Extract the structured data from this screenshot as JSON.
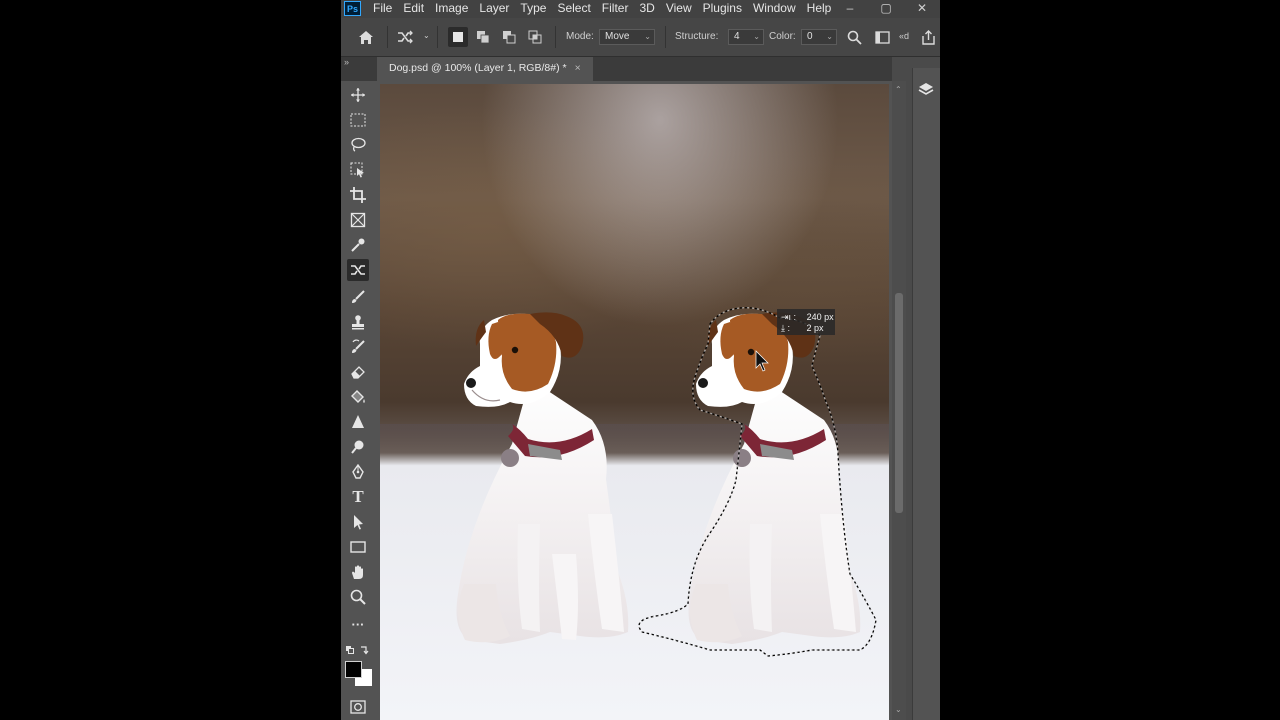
{
  "app": {
    "logo": "Ps",
    "accent": "#31a8ff"
  },
  "menu": [
    "File",
    "Edit",
    "Image",
    "Layer",
    "Type",
    "Select",
    "Filter",
    "3D",
    "View",
    "Plugins",
    "Window",
    "Help"
  ],
  "window_controls": {
    "minimize": "–",
    "maximize": "▢",
    "close": "✕"
  },
  "options": {
    "mode_label": "Mode:",
    "mode_value": "Move",
    "structure_label": "Structure:",
    "structure_value": "4",
    "color_label": "Color:",
    "color_value": "0",
    "extra_label": "«d"
  },
  "document_tab": {
    "title": "Dog.psd @ 100% (Layer 1, RGB/8#) *",
    "close": "×"
  },
  "tooltip": {
    "width_line": "240 px",
    "height_line": "2 px"
  },
  "tools": [
    "move-tool-icon",
    "marquee-tool-icon",
    "lasso-tool-icon",
    "object-selection-tool-icon",
    "crop-tool-icon",
    "frame-tool-icon",
    "eyedropper-tool-icon",
    "content-aware-move-tool-icon",
    "brush-tool-icon",
    "clone-stamp-tool-icon",
    "history-brush-tool-icon",
    "eraser-tool-icon",
    "paint-bucket-tool-icon",
    "blur-tool-icon",
    "dodge-tool-icon",
    "pen-tool-icon",
    "type-tool-icon",
    "path-selection-tool-icon",
    "rectangle-tool-icon",
    "hand-tool-icon",
    "zoom-tool-icon",
    "more-tools-icon"
  ],
  "colors": {
    "foreground": "#000000",
    "background": "#ffffff",
    "dog_brown": "#a55a24",
    "collar": "#8a2a3a"
  }
}
